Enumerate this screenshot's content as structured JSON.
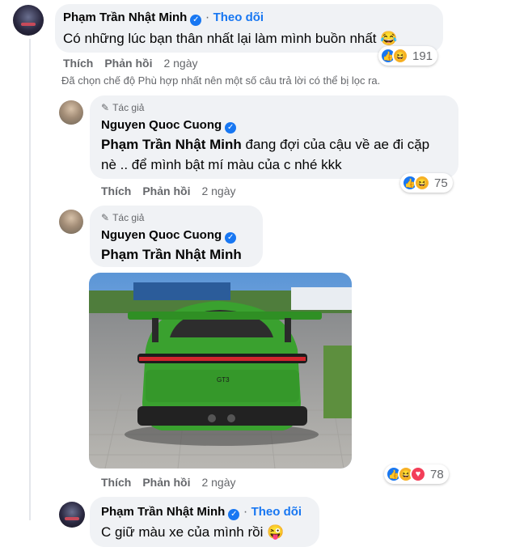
{
  "comment1": {
    "author": "Phạm Trần Nhật Minh",
    "follow": "Theo dõi",
    "text": "Có những lúc bạn thân nhất lại làm mình buồn nhất 😂",
    "actions": {
      "like": "Thích",
      "reply": "Phản hồi",
      "time": "2 ngày"
    },
    "reaction_count": "191"
  },
  "filter_notice": "Đã chọn chế độ Phù hợp nhất nên một số câu trả lời có thể bị lọc ra.",
  "reply1": {
    "badge": "Tác giả",
    "author": "Nguyen Quoc Cuong",
    "mention": "Phạm Trần Nhật Minh",
    "text_after_mention": " đang đợi của cậu về ae đi cặp nè .. để mình bật mí màu của c nhé kkk",
    "actions": {
      "like": "Thích",
      "reply": "Phản hồi",
      "time": "2 ngày"
    },
    "reaction_count": "75"
  },
  "reply2": {
    "badge": "Tác giả",
    "author": "Nguyen Quoc Cuong",
    "mention": "Phạm Trần Nhật Minh",
    "actions": {
      "like": "Thích",
      "reply": "Phản hồi",
      "time": "2 ngày"
    },
    "reaction_count": "78",
    "image_plate": "GT3"
  },
  "reply3": {
    "author": "Phạm Trần Nhật Minh",
    "follow": "Theo dõi",
    "text": "C giữ màu xe của mình rồi 😜"
  },
  "colors": {
    "accent": "#1877f2",
    "bubble": "#f0f2f5",
    "muted": "#65676b",
    "car_green": "#3aa12f"
  }
}
